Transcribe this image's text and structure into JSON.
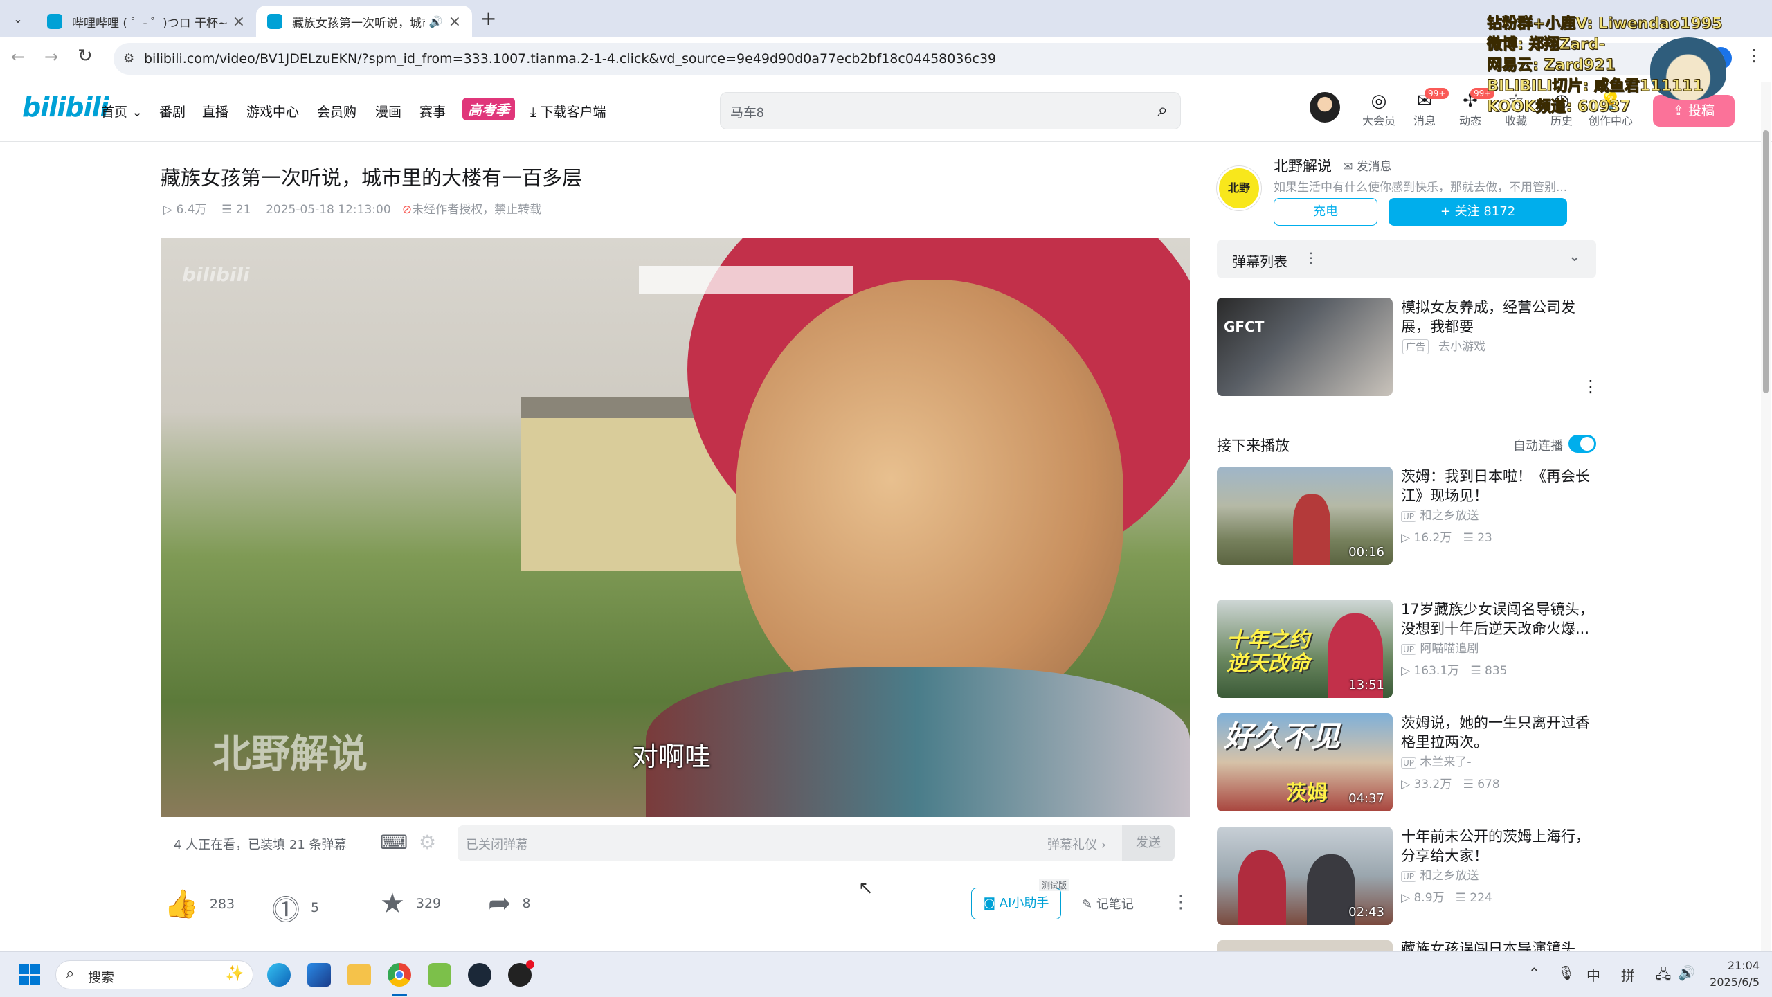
{
  "browser": {
    "tabs": [
      {
        "title": "哔哩哔哩 ( ゜- ゜)つロ 干杯~-b",
        "active": false
      },
      {
        "title": "藏族女孩第一次听说，城市",
        "active": true
      }
    ],
    "url": "bilibili.com/video/BV1JDELzuEKN/?spm_id_from=333.1007.tianma.2-1-4.click&vd_source=9e49d90d0a77ecb2bf18c04458036c39"
  },
  "header": {
    "logo": "bilibili",
    "nav": [
      "首页",
      "番剧",
      "直播",
      "游戏中心",
      "会员购",
      "漫画",
      "赛事"
    ],
    "special_nav": "高考季",
    "download": "下载客户端",
    "search_value": "马车8",
    "icons": [
      {
        "label": "大会员",
        "icon": "vip-icon"
      },
      {
        "label": "消息",
        "icon": "message-icon",
        "badge": "99+"
      },
      {
        "label": "动态",
        "icon": "dynamic-icon",
        "badge": "99+"
      },
      {
        "label": "收藏",
        "icon": "favorite-icon"
      },
      {
        "label": "历史",
        "icon": "history-icon"
      },
      {
        "label": "创作中心",
        "icon": "creator-icon"
      }
    ],
    "upload": "投稿"
  },
  "video": {
    "title": "藏族女孩第一次听说，城市里的大楼有一百多层",
    "views": "6.4万",
    "danmaku_count": "21",
    "date": "2025-05-18 12:13:00",
    "copyright": "未经作者授权，禁止转载",
    "subtitle": "对啊哇",
    "watermark": "北野解说",
    "viewers": "4 人正在看，已装填 21 条弹幕",
    "danmaku_placeholder": "已关闭弹幕",
    "danmaku_etiquette": "弹幕礼仪 ›",
    "send": "发送",
    "likes": "283",
    "coins": "5",
    "favorites": "329",
    "shares": "8",
    "ai_tag": "测试版",
    "ai_assistant": "AI小助手",
    "notes": "记笔记"
  },
  "uploader": {
    "name": "北野解说",
    "message": "发消息",
    "bio": "如果生活中有什么使你感到快乐，那就去做，不用管别...",
    "charge": "充电",
    "follow": "+ 关注 8172"
  },
  "danmaku_list": "弹幕列表",
  "ad": {
    "title": "模拟女友养成，经营公司发展，我都要",
    "tag": "广告",
    "source": "去小游戏"
  },
  "next_up": {
    "label": "接下来播放",
    "autoplay": "自动连播",
    "autoplay_on": true
  },
  "recommendations": [
    {
      "title": "茨姆：我到日本啦！《再会长江》现场见！",
      "uploader": "和之乡放送",
      "views": "16.2万",
      "danmaku": "23",
      "duration": "00:16"
    },
    {
      "title": "17岁藏族少女误闯名导镜头，没想到十年后逆天改命火爆...",
      "uploader": "阿喵喵追剧",
      "views": "163.1万",
      "danmaku": "835",
      "duration": "13:51"
    },
    {
      "title": "茨姆说，她的一生只离开过香格里拉两次。",
      "uploader": "木兰来了-",
      "views": "33.2万",
      "danmaku": "678",
      "duration": "04:37"
    },
    {
      "title": "十年前未公开的茨姆上海行，分享给大家！",
      "uploader": "和之乡放送",
      "views": "8.9万",
      "danmaku": "224",
      "duration": "02:43"
    },
    {
      "title": "藏族女孩误闯日本导演镜头",
      "uploader": "",
      "views": "",
      "danmaku": "",
      "duration": ""
    }
  ],
  "stream_overlay": [
    "钻粉群+小鹿V: Liwendao1995",
    "微博: 郑翔Zard-",
    "网易云: Zard921",
    "BILIBILI切片: 咸鱼君111111",
    "KOOK频道: 60937"
  ],
  "taskbar": {
    "search": "搜索",
    "ime1": "中",
    "ime2": "拼",
    "time": "21:04",
    "date": "2025/6/5"
  },
  "colors": {
    "accent": "#00a1d6",
    "pink": "#fb7299",
    "follow": "#00aeec"
  }
}
